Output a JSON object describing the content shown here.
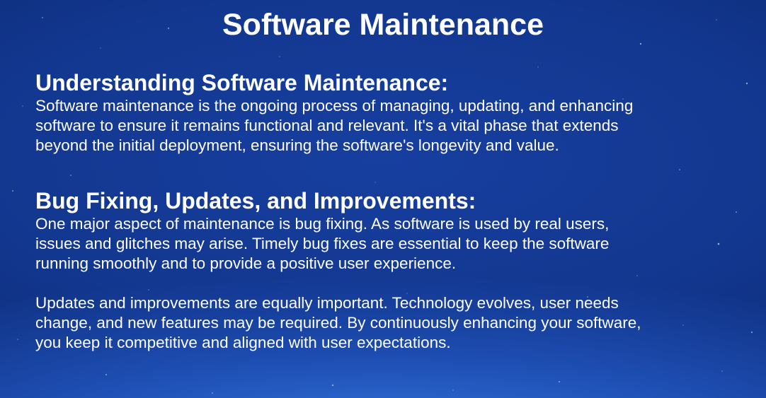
{
  "slide": {
    "title": "Software Maintenance",
    "sections": [
      {
        "heading": "Understanding Software Maintenance:",
        "paragraphs": [
          {
            "lines": [
              "Software maintenance is the ongoing process of managing, updating, and enhancing",
              "software to ensure it remains functional and relevant. It's a vital phase that extends",
              "beyond the initial deployment, ensuring the software's longevity and value."
            ]
          }
        ]
      },
      {
        "heading": "Bug Fixing, Updates, and Improvements:",
        "paragraphs": [
          {
            "lines": [
              "One major aspect of maintenance is bug fixing. As software is used by real users,",
              "issues and glitches may arise. Timely bug fixes are essential to keep the software",
              "running smoothly and to provide a positive user experience."
            ]
          },
          {
            "lines": [
              "Updates and improvements are equally important. Technology evolves, user needs",
              "change, and new features may be required. By continuously enhancing your software,",
              "you keep it competitive and aligned with user expectations."
            ]
          }
        ]
      }
    ]
  }
}
